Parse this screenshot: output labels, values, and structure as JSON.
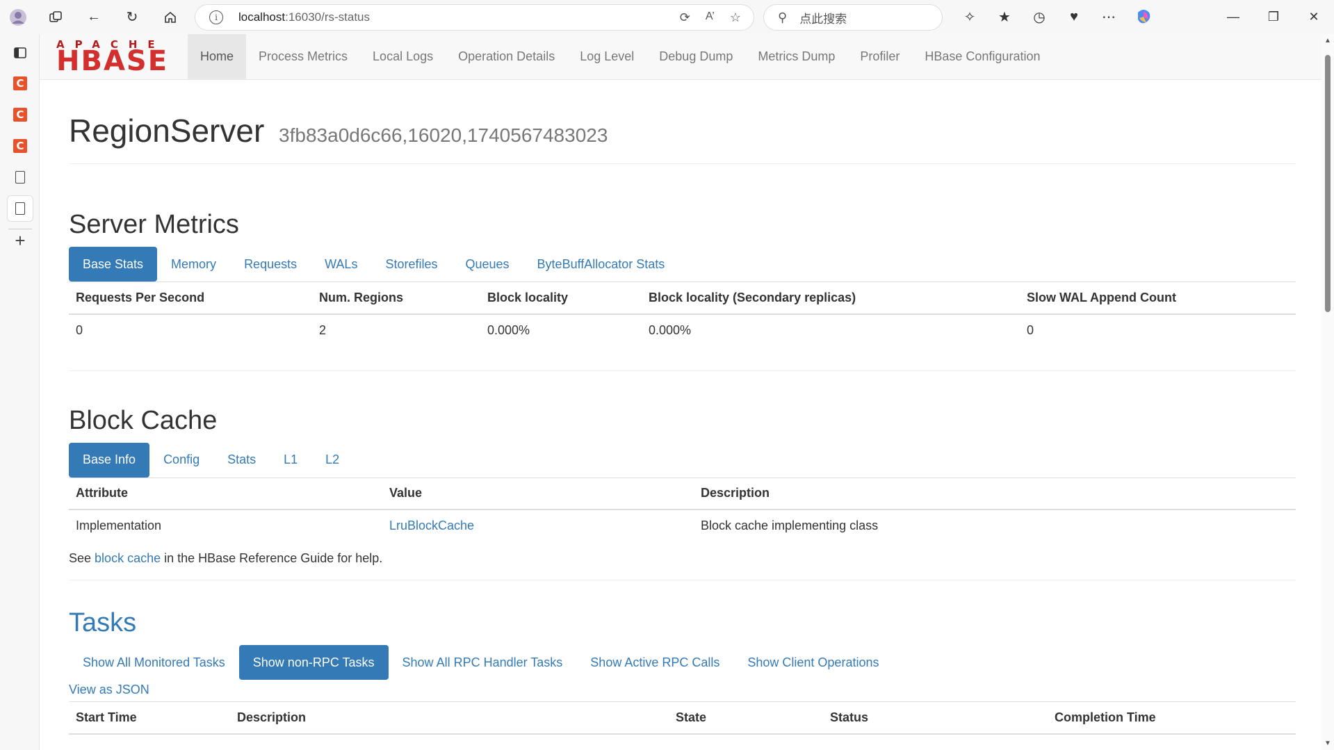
{
  "browser": {
    "address_host": "localhost",
    "address_path": ":16030/rs-status",
    "search_placeholder": "点此搜索"
  },
  "navbar": {
    "brand_top": "APACHE",
    "brand_main": "HBASE",
    "items": [
      "Home",
      "Process Metrics",
      "Local Logs",
      "Operation Details",
      "Log Level",
      "Debug Dump",
      "Metrics Dump",
      "Profiler",
      "HBase Configuration"
    ]
  },
  "header": {
    "title": "RegionServer",
    "subtitle": "3fb83a0d6c66,16020,1740567483023"
  },
  "server_metrics": {
    "title": "Server Metrics",
    "tabs": [
      "Base Stats",
      "Memory",
      "Requests",
      "WALs",
      "Storefiles",
      "Queues",
      "ByteBuffAllocator Stats"
    ],
    "columns": [
      "Requests Per Second",
      "Num. Regions",
      "Block locality",
      "Block locality (Secondary replicas)",
      "Slow WAL Append Count"
    ],
    "row": [
      "0",
      "2",
      "0.000%",
      "0.000%",
      "0"
    ]
  },
  "block_cache": {
    "title": "Block Cache",
    "tabs": [
      "Base Info",
      "Config",
      "Stats",
      "L1",
      "L2"
    ],
    "columns": [
      "Attribute",
      "Value",
      "Description"
    ],
    "row": [
      "Implementation",
      "LruBlockCache",
      "Block cache implementing class"
    ],
    "help_pre": "See",
    "help_link": "block cache",
    "help_post": "in the HBase Reference Guide for help."
  },
  "tasks": {
    "title": "Tasks",
    "tabs": [
      "Show All Monitored Tasks",
      "Show non-RPC Tasks",
      "Show All RPC Handler Tasks",
      "Show Active RPC Calls",
      "Show Client Operations"
    ],
    "json_link": "View as JSON",
    "columns": [
      "Start Time",
      "Description",
      "State",
      "Status",
      "Completion Time"
    ]
  },
  "colors": {
    "accent": "#337ab7",
    "brand": "#d32f2f",
    "badge": "#e8522a"
  }
}
